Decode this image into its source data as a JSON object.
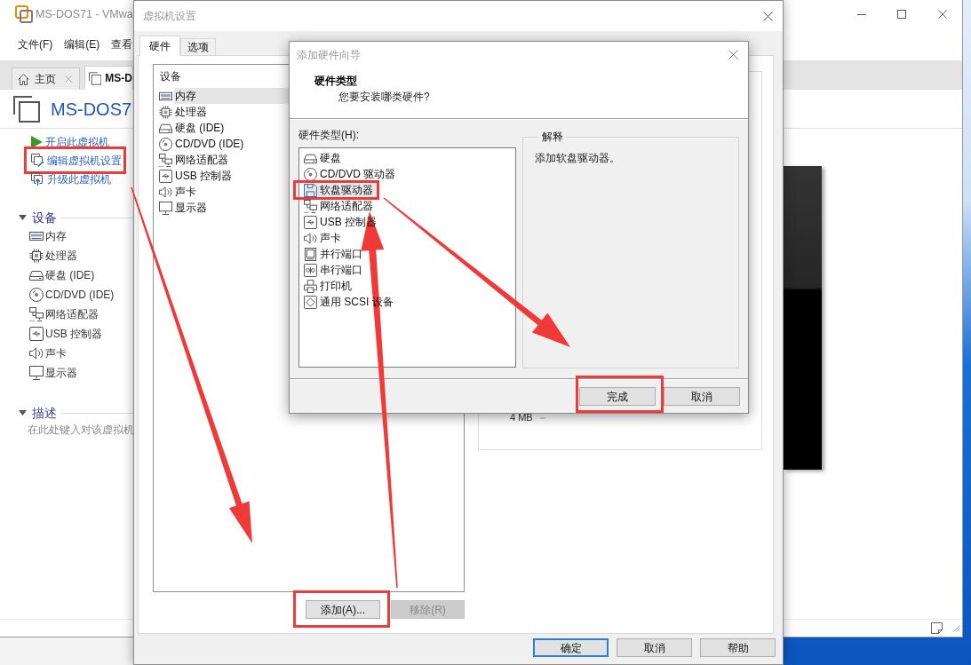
{
  "main_window": {
    "title": "MS-DOS71 - VMwa",
    "menu": [
      "文件(F)",
      "编辑(E)",
      "查看"
    ],
    "tabs": [
      {
        "kind": "home",
        "label": "主页",
        "selected": false,
        "closable": true
      },
      {
        "kind": "vm",
        "label": "MS-D",
        "selected": true,
        "closable": false
      }
    ],
    "vm_name": "MS-DOS7",
    "actions": [
      {
        "kind": "power_on",
        "label": "开启此虚拟机",
        "highlighted": false
      },
      {
        "kind": "edit",
        "label": "编辑虚拟机设置",
        "highlighted": true
      },
      {
        "kind": "upgrade",
        "label": "升级此虚拟机",
        "highlighted": false
      }
    ],
    "sections": [
      {
        "kind": "devices",
        "title": "设备",
        "expanded": true,
        "items": [
          {
            "kind": "memory",
            "label": "内存"
          },
          {
            "kind": "cpu",
            "label": "处理器"
          },
          {
            "kind": "hdd",
            "label": "硬盘 (IDE)"
          },
          {
            "kind": "cdrom",
            "label": "CD/DVD (IDE)"
          },
          {
            "kind": "network",
            "label": "网络适配器"
          },
          {
            "kind": "usb",
            "label": "USB 控制器"
          },
          {
            "kind": "sound",
            "label": "声卡"
          },
          {
            "kind": "display",
            "label": "显示器"
          }
        ]
      },
      {
        "kind": "description",
        "title": "描述",
        "expanded": true,
        "placeholder": "在此处键入对该虚拟机"
      }
    ]
  },
  "settings_dialog": {
    "title": "虚拟机设置",
    "tabs": [
      {
        "label": "硬件",
        "selected": true
      },
      {
        "label": "选项",
        "selected": false
      }
    ],
    "device_list": {
      "column": "设备",
      "items": [
        {
          "kind": "memory",
          "label": "内存",
          "selected": true
        },
        {
          "kind": "cpu",
          "label": "处理器",
          "selected": false
        },
        {
          "kind": "hdd",
          "label": "硬盘 (IDE)",
          "selected": false
        },
        {
          "kind": "cdrom",
          "label": "CD/DVD (IDE)",
          "selected": false
        },
        {
          "kind": "network",
          "label": "网络适配器",
          "selected": false
        },
        {
          "kind": "usb",
          "label": "USB 控制器",
          "selected": false
        },
        {
          "kind": "sound",
          "label": "声卡",
          "selected": false
        },
        {
          "kind": "display",
          "label": "显示器",
          "selected": false
        }
      ]
    },
    "list_buttons": [
      {
        "label": "添加(A)...",
        "disabled": false,
        "highlighted": true
      },
      {
        "label": "移除(R)",
        "disabled": true,
        "highlighted": false
      }
    ],
    "memory_scale_label": "4 MB",
    "buttons": [
      {
        "label": "确定",
        "default": true
      },
      {
        "label": "取消",
        "default": false
      },
      {
        "label": "帮助",
        "default": false
      }
    ]
  },
  "wizard": {
    "title": "添加硬件向导",
    "heading": "硬件类型",
    "question": "您要安装哪类硬件?",
    "list_label": "硬件类型(H):",
    "items": [
      {
        "kind": "hdd",
        "label": "硬盘",
        "selected": false,
        "highlighted": false
      },
      {
        "kind": "cdrom",
        "label": "CD/DVD 驱动器",
        "selected": false,
        "highlighted": false
      },
      {
        "kind": "floppy",
        "label": "软盘驱动器",
        "selected": true,
        "highlighted": true
      },
      {
        "kind": "network",
        "label": "网络适配器",
        "selected": false,
        "highlighted": false
      },
      {
        "kind": "usb",
        "label": "USB 控制器",
        "selected": false,
        "highlighted": false
      },
      {
        "kind": "sound",
        "label": "声卡",
        "selected": false,
        "highlighted": false
      },
      {
        "kind": "parallel",
        "label": "并行端口",
        "selected": false,
        "highlighted": false
      },
      {
        "kind": "serial",
        "label": "串行端口",
        "selected": false,
        "highlighted": false
      },
      {
        "kind": "printer",
        "label": "打印机",
        "selected": false,
        "highlighted": false
      },
      {
        "kind": "scsi",
        "label": "通用 SCSI 设备",
        "selected": false,
        "highlighted": false
      }
    ],
    "explanation_title": "解释",
    "explanation": "添加软盘驱动器。",
    "buttons": [
      {
        "label": "完成",
        "highlighted": true
      },
      {
        "label": "取消",
        "highlighted": false
      }
    ]
  }
}
